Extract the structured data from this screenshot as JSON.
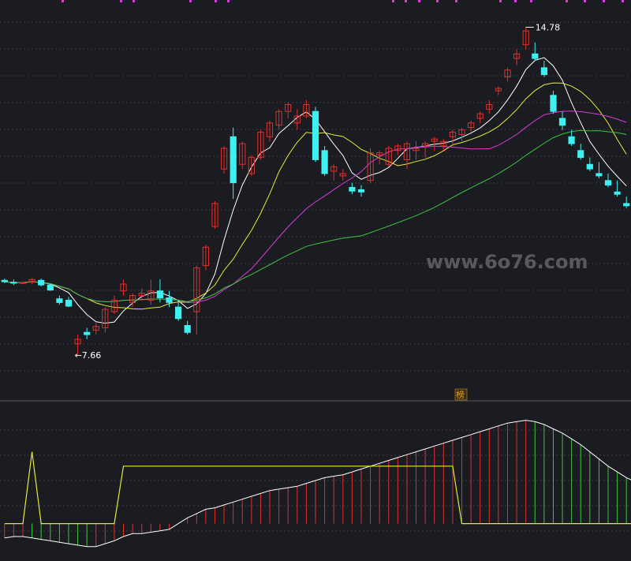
{
  "chart_data": [
    {
      "type": "candlestick",
      "title": "",
      "xlabel": "",
      "ylabel": "",
      "ylim": [
        6.8,
        15.2
      ],
      "grid": true,
      "legend": "none",
      "annotations": [
        {
          "text": "14.78",
          "bar_index": 57,
          "value": 14.78,
          "kind": "high"
        },
        {
          "text": "←7.66",
          "bar_index": 8,
          "value": 7.66,
          "kind": "low"
        }
      ],
      "marker_label": "榜",
      "candles": [
        [
          9.28,
          9.32,
          9.22,
          9.25
        ],
        [
          9.24,
          9.3,
          9.18,
          9.22
        ],
        [
          9.22,
          9.26,
          9.2,
          9.23
        ],
        [
          9.24,
          9.33,
          9.2,
          9.3
        ],
        [
          9.28,
          9.32,
          9.15,
          9.18
        ],
        [
          9.18,
          9.2,
          9.05,
          9.07
        ],
        [
          8.88,
          8.95,
          8.75,
          8.8
        ],
        [
          8.85,
          8.92,
          8.7,
          8.72
        ],
        [
          7.9,
          8.1,
          7.66,
          8.0
        ],
        [
          8.15,
          8.25,
          8.0,
          8.1
        ],
        [
          8.2,
          8.35,
          8.1,
          8.28
        ],
        [
          8.25,
          8.7,
          8.15,
          8.65
        ],
        [
          8.6,
          8.95,
          8.55,
          8.85
        ],
        [
          9.05,
          9.3,
          8.95,
          9.2
        ],
        [
          8.8,
          9.0,
          8.7,
          8.95
        ],
        [
          8.95,
          9.1,
          8.85,
          9.0
        ],
        [
          8.85,
          9.3,
          8.75,
          9.05
        ],
        [
          9.05,
          9.3,
          8.8,
          8.9
        ],
        [
          8.9,
          9.05,
          8.7,
          8.8
        ],
        [
          8.7,
          8.85,
          8.4,
          8.45
        ],
        [
          8.3,
          8.4,
          8.1,
          8.15
        ],
        [
          8.6,
          9.6,
          8.1,
          9.55
        ],
        [
          9.6,
          10.05,
          9.5,
          10.0
        ],
        [
          10.45,
          11.0,
          10.4,
          10.95
        ],
        [
          11.7,
          12.2,
          11.6,
          12.15
        ],
        [
          12.4,
          12.6,
          11.05,
          11.4
        ],
        [
          11.8,
          12.3,
          11.7,
          12.25
        ],
        [
          11.6,
          12.0,
          11.55,
          11.95
        ],
        [
          11.95,
          12.55,
          11.9,
          12.5
        ],
        [
          12.4,
          12.75,
          12.3,
          12.7
        ],
        [
          12.65,
          13.0,
          12.55,
          12.95
        ],
        [
          12.95,
          13.15,
          12.8,
          13.1
        ],
        [
          12.7,
          13.0,
          12.55,
          12.85
        ],
        [
          12.85,
          13.2,
          12.8,
          13.1
        ],
        [
          12.95,
          13.05,
          11.85,
          11.9
        ],
        [
          12.1,
          12.2,
          11.55,
          11.6
        ],
        [
          11.65,
          11.8,
          11.45,
          11.75
        ],
        [
          11.55,
          11.7,
          11.45,
          11.6
        ],
        [
          11.3,
          11.4,
          11.15,
          11.22
        ],
        [
          11.25,
          11.35,
          11.1,
          11.2
        ],
        [
          11.45,
          12.15,
          11.4,
          12.05
        ],
        [
          12.0,
          12.1,
          11.8,
          12.05
        ],
        [
          11.8,
          12.2,
          11.75,
          12.15
        ],
        [
          12.1,
          12.25,
          12.0,
          12.2
        ],
        [
          11.9,
          12.3,
          11.7,
          12.25
        ],
        [
          12.1,
          12.3,
          11.9,
          12.15
        ],
        [
          12.2,
          12.3,
          11.95,
          12.25
        ],
        [
          12.3,
          12.4,
          12.1,
          12.35
        ],
        [
          12.2,
          12.35,
          12.1,
          12.3
        ],
        [
          12.4,
          12.55,
          12.2,
          12.5
        ],
        [
          12.45,
          12.6,
          12.3,
          12.55
        ],
        [
          12.6,
          12.75,
          12.5,
          12.7
        ],
        [
          12.8,
          12.95,
          12.7,
          12.9
        ],
        [
          13.0,
          13.2,
          12.9,
          13.1
        ],
        [
          13.4,
          13.5,
          13.3,
          13.45
        ],
        [
          13.7,
          13.9,
          13.6,
          13.85
        ],
        [
          14.1,
          14.3,
          13.95,
          14.2
        ],
        [
          14.4,
          14.78,
          14.3,
          14.7
        ],
        [
          14.2,
          14.45,
          14.05,
          14.1
        ],
        [
          13.9,
          14.05,
          13.7,
          13.75
        ],
        [
          13.3,
          13.4,
          12.9,
          12.95
        ],
        [
          12.8,
          12.95,
          12.55,
          12.65
        ],
        [
          12.4,
          12.55,
          12.2,
          12.25
        ],
        [
          12.1,
          12.25,
          11.9,
          11.95
        ],
        [
          11.8,
          11.95,
          11.65,
          11.7
        ],
        [
          11.6,
          11.85,
          11.5,
          11.55
        ],
        [
          11.45,
          11.6,
          11.3,
          11.35
        ],
        [
          11.2,
          11.45,
          11.1,
          11.15
        ],
        [
          10.95,
          11.1,
          10.85,
          10.9
        ]
      ],
      "oscillator": {
        "ylim": [
          0,
          100
        ],
        "curve": [
          10,
          11,
          11,
          10,
          9,
          8,
          7,
          6,
          5,
          4,
          4,
          6,
          8,
          11,
          13,
          13,
          14,
          15,
          16,
          20,
          24,
          27,
          30,
          31,
          33,
          35,
          37,
          39,
          41,
          43,
          44,
          45,
          46,
          48,
          50,
          52,
          53,
          54,
          56,
          58,
          60,
          62,
          64,
          66,
          68,
          70,
          72,
          74,
          76,
          78,
          80,
          82,
          84,
          86,
          88,
          90,
          91,
          92,
          91,
          89,
          86,
          83,
          79,
          75,
          70,
          65,
          60,
          56,
          52,
          49
        ],
        "ceiling": [
          20,
          20,
          20,
          70,
          20,
          20,
          20,
          20,
          20,
          20,
          20,
          20,
          20,
          60,
          60,
          60,
          60,
          60,
          60,
          60,
          60,
          60,
          60,
          60,
          60,
          60,
          60,
          60,
          60,
          60,
          60,
          60,
          60,
          60,
          60,
          60,
          60,
          60,
          60,
          60,
          60,
          60,
          60,
          60,
          60,
          60,
          60,
          60,
          60,
          60,
          20,
          20,
          20,
          20,
          20,
          20,
          20,
          20,
          20,
          20,
          20,
          20,
          20,
          20,
          20,
          20,
          20,
          20,
          20,
          20
        ]
      }
    }
  ],
  "colors": {
    "background": "#1b1c21",
    "grid": "#3a3c44",
    "up": "#e0302c",
    "down": "#3ff0f0",
    "ma_white": "#ffffff",
    "ma_yellow": "#e8e83a",
    "ma_magenta": "#d93cd9",
    "ma_green": "#3ec43e",
    "annotation_text": "#ffffff",
    "marker": "#e8a020",
    "watermark": "#8a8a94"
  },
  "watermark": "www.6o76.com"
}
